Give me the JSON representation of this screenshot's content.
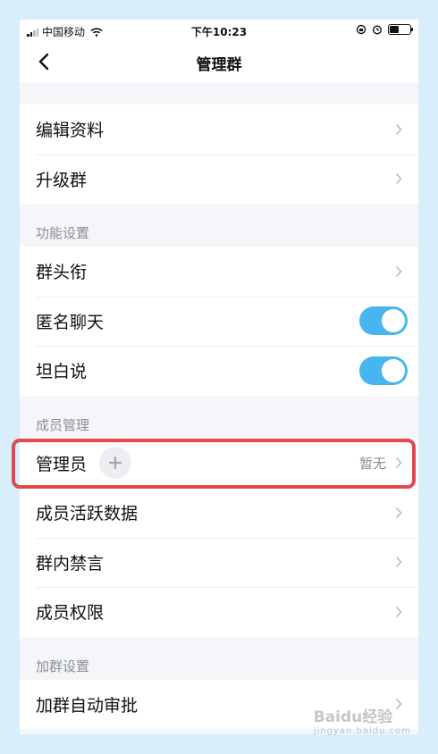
{
  "status_bar": {
    "carrier": "中国移动",
    "time": "下午10:23"
  },
  "nav": {
    "title": "管理群",
    "back_icon": "chevron-left-icon"
  },
  "groups": {
    "basic": [
      {
        "label": "编辑资料"
      },
      {
        "label": "升级群"
      }
    ],
    "function_settings": {
      "header": "功能设置",
      "items": [
        {
          "label": "群头衔"
        },
        {
          "label": "匿名聊天",
          "toggle": true
        },
        {
          "label": "坦白说",
          "toggle": true
        }
      ]
    },
    "member_management": {
      "header": "成员管理",
      "items": [
        {
          "label": "管理员",
          "value": "暂无"
        },
        {
          "label": "成员活跃数据"
        },
        {
          "label": "群内禁言"
        },
        {
          "label": "成员权限"
        }
      ]
    },
    "join_settings": {
      "header": "加群设置",
      "items": [
        {
          "label": "加群自动审批"
        }
      ]
    }
  },
  "colors": {
    "toggle_on": "#47b6f0",
    "highlight": "#e2484c",
    "background": "#d8eefb"
  },
  "watermark": {
    "brand": "Baidu经验",
    "sub": "jingyan.baidu.com"
  }
}
